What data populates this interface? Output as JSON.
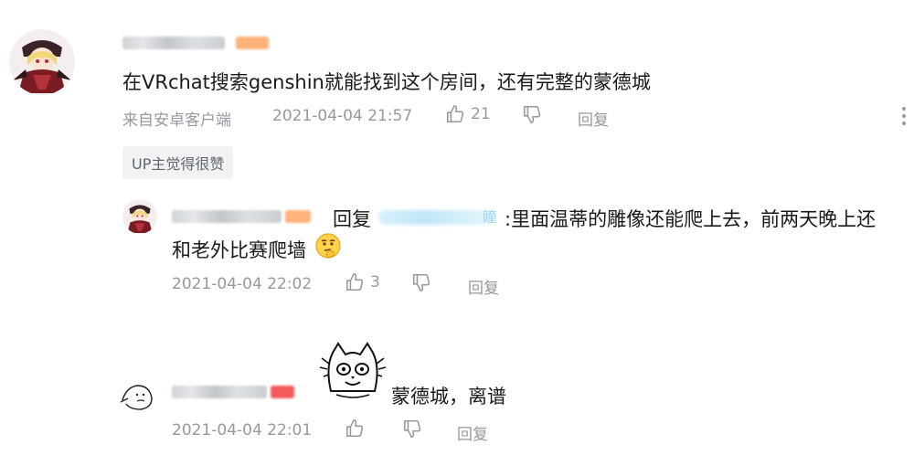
{
  "comment1": {
    "text": "在VRchat搜索genshin就能找到这个房间，还有完整的蒙德城",
    "source": "来自安卓客户端",
    "time": "2021-04-04 21:57",
    "likes": "21",
    "reply_label": "回复",
    "badge": "UP主觉得很赞"
  },
  "reply1": {
    "reply_prefix": "回复",
    "target_tail": "瞳",
    "text_line1": ":里面温蒂的雕像还能爬上去，前两天晚上还",
    "text_line2": "和老外比赛爬墙",
    "time": "2021-04-04 22:02",
    "likes": "3",
    "reply_label": "回复"
  },
  "comment2": {
    "text": "蒙德城，离谱",
    "time": "2021-04-04 22:01",
    "reply_label": "回复"
  },
  "colors": {
    "text": "#18191c",
    "meta": "#9499a0",
    "badge_bg": "#f1f2f3",
    "level_orange": "#ffb27a",
    "level_red": "#f45a5a"
  }
}
